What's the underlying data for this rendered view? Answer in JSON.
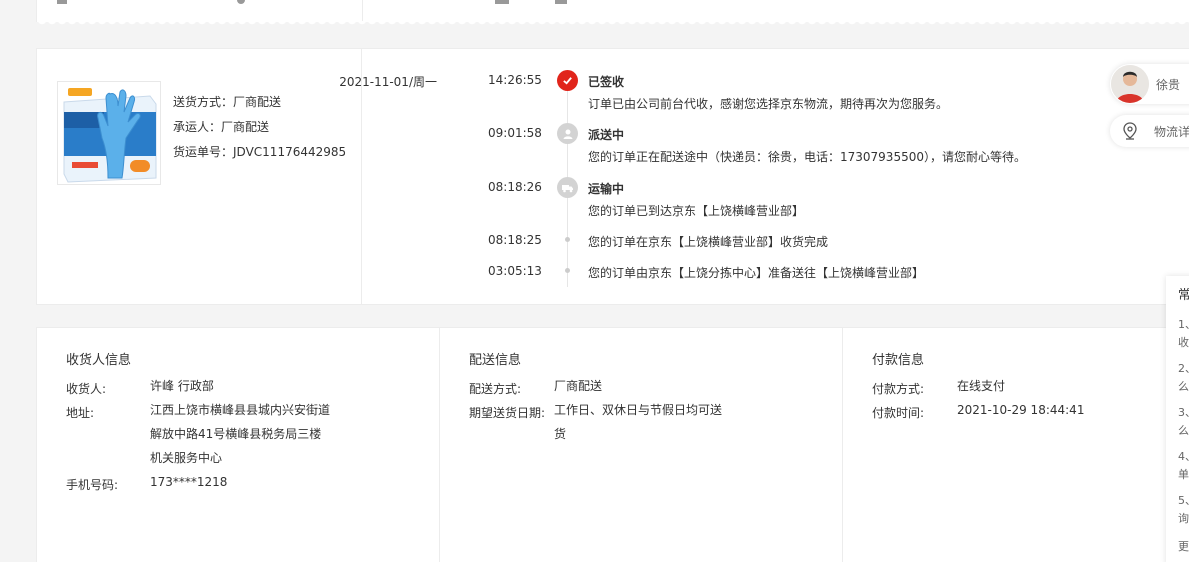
{
  "shipment": {
    "method_label": "送货方式：",
    "method_value": "厂商配送",
    "carrier_label": "承运人：",
    "carrier_value": "厂商配送",
    "tracking_label": "货运单号：",
    "tracking_value": "JDVC11176442985"
  },
  "timeline": [
    {
      "date": "2021-11-01/周一",
      "time": "14:26:55",
      "status": "已签收",
      "desc": "订单已由公司前台代收，感谢您选择京东物流，期待再次为您服务。"
    },
    {
      "date": "",
      "time": "09:01:58",
      "status": "派送中",
      "desc": "您的订单正在配送途中（快递员：徐贵，电话：17307935500），请您耐心等待。"
    },
    {
      "date": "",
      "time": "08:18:26",
      "status": "运输中",
      "desc": "您的订单已到达京东【上饶横峰营业部】"
    },
    {
      "date": "",
      "time": "08:18:25",
      "status": "",
      "desc": "您的订单在京东【上饶横峰营业部】收货完成"
    },
    {
      "date": "",
      "time": "03:05:13",
      "status": "",
      "desc": "您的订单由京东【上饶分拣中心】准备送往【上饶横峰营业部】"
    }
  ],
  "courier": {
    "name": "徐贵"
  },
  "detail_link": {
    "label": "物流详"
  },
  "receiver": {
    "title": "收货人信息",
    "name_label": "收货人:",
    "name_value": "许峰 行政部",
    "address_label": "地址:",
    "address_value": "江西上饶市横峰县县城内兴安街道 解放中路41号横峰县税务局三楼机关服务中心",
    "phone_label": "手机号码:",
    "phone_value": "173****1218"
  },
  "delivery": {
    "title": "配送信息",
    "method_label": "配送方式:",
    "method_value": "厂商配送",
    "date_label": "期望送货日期:",
    "date_value": "工作日、双休日与节假日均可送货"
  },
  "payment": {
    "title": "付款信息",
    "method_label": "付款方式:",
    "method_value": "在线支付",
    "time_label": "付款时间:",
    "time_value": "2021-10-29 18:44:41"
  },
  "faq": {
    "title": "常",
    "lines": [
      "1、",
      "收",
      "2、",
      "么",
      "3、",
      "么",
      "4、",
      "单",
      "5、",
      "询",
      "更"
    ]
  },
  "colors": {
    "accent_red": "#e1251b",
    "node_gray": "#d3d3d3",
    "border": "#ececec"
  }
}
